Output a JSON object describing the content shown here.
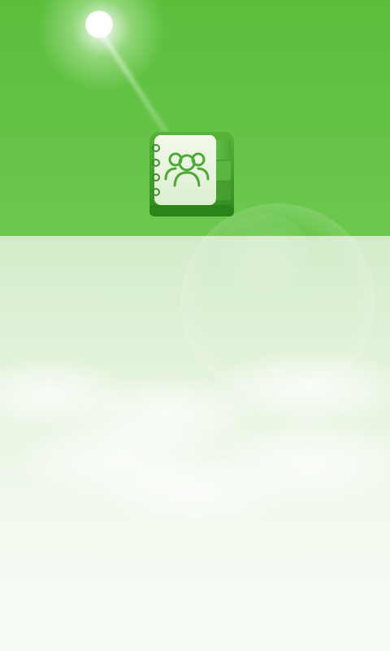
{
  "screen": {
    "type": "splash-screen",
    "logo_icon": "address-book-icon",
    "colors": {
      "top_background": "#5bbf3c",
      "bottom_background": "#f6fbf3",
      "icon_green": "#4aa62e",
      "icon_page": "#ecf6e4"
    }
  }
}
